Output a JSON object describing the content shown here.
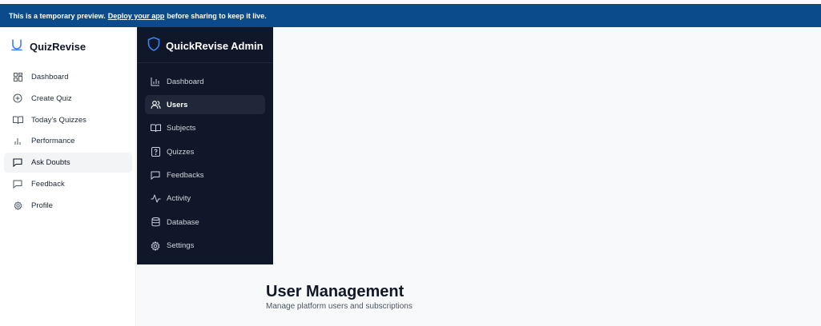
{
  "banner": {
    "prefix": "This is a temporary preview.",
    "link": "Deploy your app",
    "suffix": "before sharing to keep it live."
  },
  "student": {
    "brand": "QuizRevise",
    "nav": [
      {
        "label": "Dashboard",
        "icon": "grid-icon"
      },
      {
        "label": "Create Quiz",
        "icon": "plus-circle-icon"
      },
      {
        "label": "Today's Quizzes",
        "icon": "book-icon"
      },
      {
        "label": "Performance",
        "icon": "bar-chart-icon"
      },
      {
        "label": "Ask Doubts",
        "icon": "message-icon",
        "active": true
      },
      {
        "label": "Feedback",
        "icon": "message-icon"
      },
      {
        "label": "Profile",
        "icon": "gear-icon"
      }
    ]
  },
  "admin": {
    "title": "QuickRevise Admin",
    "nav": [
      {
        "label": "Dashboard",
        "icon": "bar-chart-icon"
      },
      {
        "label": "Users",
        "icon": "users-icon",
        "active": true
      },
      {
        "label": "Subjects",
        "icon": "book-icon"
      },
      {
        "label": "Quizzes",
        "icon": "help-file-icon"
      },
      {
        "label": "Feedbacks",
        "icon": "message-icon"
      },
      {
        "label": "Activity",
        "icon": "activity-icon"
      },
      {
        "label": "Database",
        "icon": "database-icon"
      },
      {
        "label": "Settings",
        "icon": "gear-icon"
      }
    ]
  },
  "page": {
    "title": "User Management",
    "subtitle": "Manage platform users and subscriptions"
  },
  "colors": {
    "banner": "#0b4a8b",
    "admin_bg": "#0f1729",
    "accent": "#3b82f6"
  }
}
